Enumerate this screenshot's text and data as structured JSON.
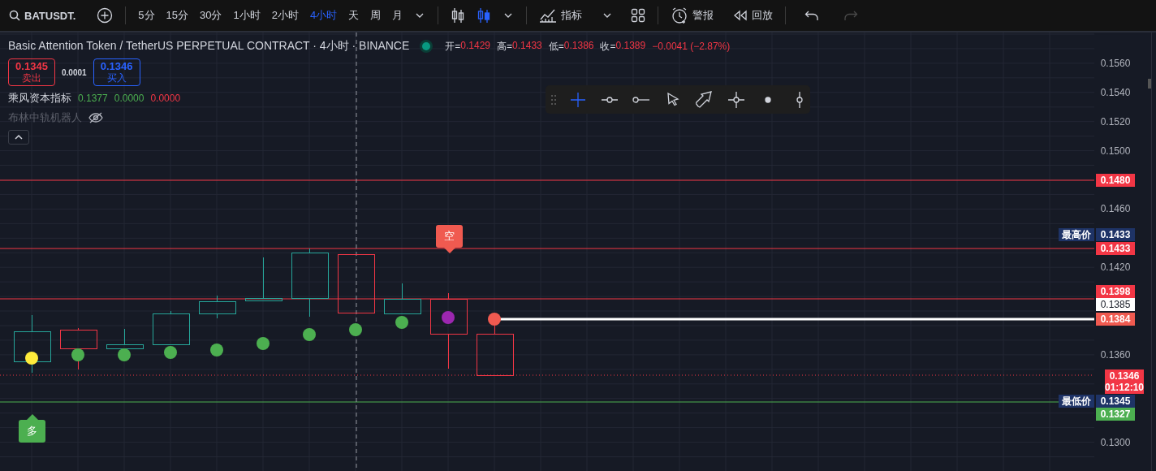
{
  "toolbar": {
    "symbol": "BATUSDT.",
    "intervals": [
      {
        "label": "5分",
        "selected": false
      },
      {
        "label": "15分",
        "selected": false
      },
      {
        "label": "30分",
        "selected": false
      },
      {
        "label": "1小时",
        "selected": false
      },
      {
        "label": "2小时",
        "selected": false
      },
      {
        "label": "4小时",
        "selected": true
      },
      {
        "label": "天",
        "selected": false
      },
      {
        "label": "周",
        "selected": false
      },
      {
        "label": "月",
        "selected": false
      }
    ],
    "chart_types": [
      {
        "kind": "hollow-candles",
        "selected": false
      },
      {
        "kind": "candles",
        "selected": true
      }
    ],
    "indicators_label": "指标",
    "alert_label": "警报",
    "replay_label": "回放",
    "history": [
      {
        "kind": "undo",
        "disabled": false
      },
      {
        "kind": "redo",
        "disabled": true
      }
    ]
  },
  "legend": {
    "title": "Basic Attention Token / TetherUS PERPETUAL CONTRACT · 4小时 · BINANCE",
    "market_open": true,
    "ohlc": [
      {
        "label": "开=",
        "value": "0.1429"
      },
      {
        "label": "高=",
        "value": "0.1433"
      },
      {
        "label": "低=",
        "value": "0.1386"
      },
      {
        "label": "收=",
        "value": "0.1389"
      }
    ],
    "change": "−0.0041 (−2.87%)",
    "sell": {
      "price": "0.1345",
      "label": "卖出"
    },
    "spread": "0.0001",
    "buy": {
      "price": "0.1346",
      "label": "买入"
    },
    "indicators": [
      {
        "name": "乘风资本指标",
        "hidden": false,
        "values": [
          {
            "text": "0.1377",
            "color": "#4caf50"
          },
          {
            "text": "0.0000",
            "color": "#4caf50"
          },
          {
            "text": "0.0000",
            "color": "#f23645"
          }
        ]
      },
      {
        "name": "布林中轨机器人",
        "hidden": true
      }
    ]
  },
  "drawing_tools": [
    {
      "kind": "crosshair",
      "selected": true
    },
    {
      "kind": "segment",
      "selected": false
    },
    {
      "kind": "ray",
      "selected": false
    },
    {
      "kind": "cursor",
      "selected": false
    },
    {
      "kind": "arrow",
      "selected": false
    },
    {
      "kind": "cross-point",
      "selected": false
    },
    {
      "kind": "dot",
      "selected": false
    },
    {
      "kind": "vertical-line",
      "selected": false
    }
  ],
  "signals": [
    {
      "kind": "short",
      "text": "空"
    },
    {
      "kind": "long",
      "text": "多"
    }
  ],
  "price_axis": [
    {
      "kind": "tick",
      "text": "0.1560"
    },
    {
      "kind": "tick",
      "text": "0.1540"
    },
    {
      "kind": "tick",
      "text": "0.1520"
    },
    {
      "kind": "tick",
      "text": "0.1500"
    },
    {
      "kind": "badge",
      "text": "0.1480",
      "color": "#f23645"
    },
    {
      "kind": "tick",
      "text": "0.1460"
    },
    {
      "kind": "badge",
      "tag": "最高价",
      "text": "0.1433",
      "color": "#1e3366"
    },
    {
      "kind": "badge",
      "text": "0.1433",
      "color": "#f23645"
    },
    {
      "kind": "tick",
      "text": "0.1420"
    },
    {
      "kind": "badge",
      "text": "0.1398",
      "color": "#f23645"
    },
    {
      "kind": "badge",
      "text": "0.1385",
      "color": "#ffffff"
    },
    {
      "kind": "badge",
      "text": "0.1384",
      "color": "#f05a50"
    },
    {
      "kind": "tick",
      "text": "0.1360"
    },
    {
      "kind": "badge",
      "text": "0.1346",
      "countdown": "01:12:10",
      "color": "#f23645"
    },
    {
      "kind": "badge",
      "tag": "最低价",
      "text": "0.1345",
      "color": "#1e3366"
    },
    {
      "kind": "badge",
      "text": "0.1327",
      "color": "#4caf50"
    },
    {
      "kind": "tick",
      "text": "0.1300"
    }
  ]
}
